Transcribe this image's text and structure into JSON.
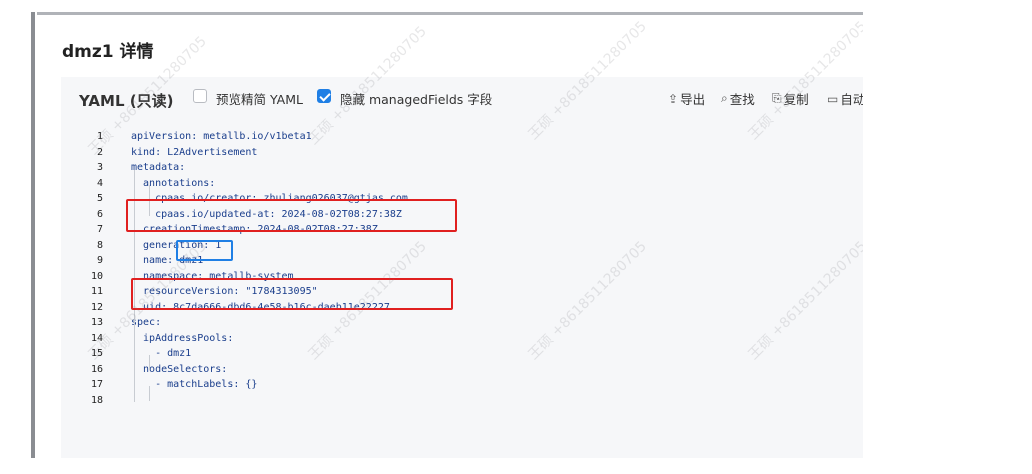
{
  "modal": {
    "title": "dmz1 详情"
  },
  "toolbar": {
    "yaml_label": "YAML (只读)",
    "preview_label": "预览精简 YAML",
    "preview_checked": false,
    "hide_managed_label": "隐藏 managedFields 字段",
    "hide_managed_checked": true,
    "export_label": "导出",
    "search_label": "查找",
    "copy_label": "复制",
    "auto_label": "自动"
  },
  "editor": {
    "lines": [
      {
        "n": "1",
        "text": "apiVersion: metallb.io/v1beta1"
      },
      {
        "n": "2",
        "text": "kind: L2Advertisement"
      },
      {
        "n": "3",
        "text": "metadata:"
      },
      {
        "n": "4",
        "text": "  annotations:"
      },
      {
        "n": "5",
        "text": "    cpaas.io/creator: zhuliang026037@gtjas.com"
      },
      {
        "n": "6",
        "text": "    cpaas.io/updated-at: 2024-08-02T08:27:38Z"
      },
      {
        "n": "7",
        "text": "  creationTimestamp: 2024-08-02T08:27:38Z"
      },
      {
        "n": "8",
        "text": "  generation: 1"
      },
      {
        "n": "9",
        "text": "  name: dmz1"
      },
      {
        "n": "10",
        "text": "  namespace: metallb-system"
      },
      {
        "n": "11",
        "text": "  resourceVersion: \"1784313095\""
      },
      {
        "n": "12",
        "text": "  uid: 8c7da666-dbd6-4e58-b16c-daeb11e22227"
      },
      {
        "n": "13",
        "text": "spec:"
      },
      {
        "n": "14",
        "text": "  ipAddressPools:"
      },
      {
        "n": "15",
        "text": "    - dmz1"
      },
      {
        "n": "16",
        "text": "  nodeSelectors:"
      },
      {
        "n": "17",
        "text": "    - matchLabels: {}"
      },
      {
        "n": "18",
        "text": ""
      }
    ]
  },
  "watermark": {
    "text": "王硕 +8618511280705"
  },
  "colors": {
    "accent": "#1f7fe5",
    "highlight_red": "#e02020"
  }
}
